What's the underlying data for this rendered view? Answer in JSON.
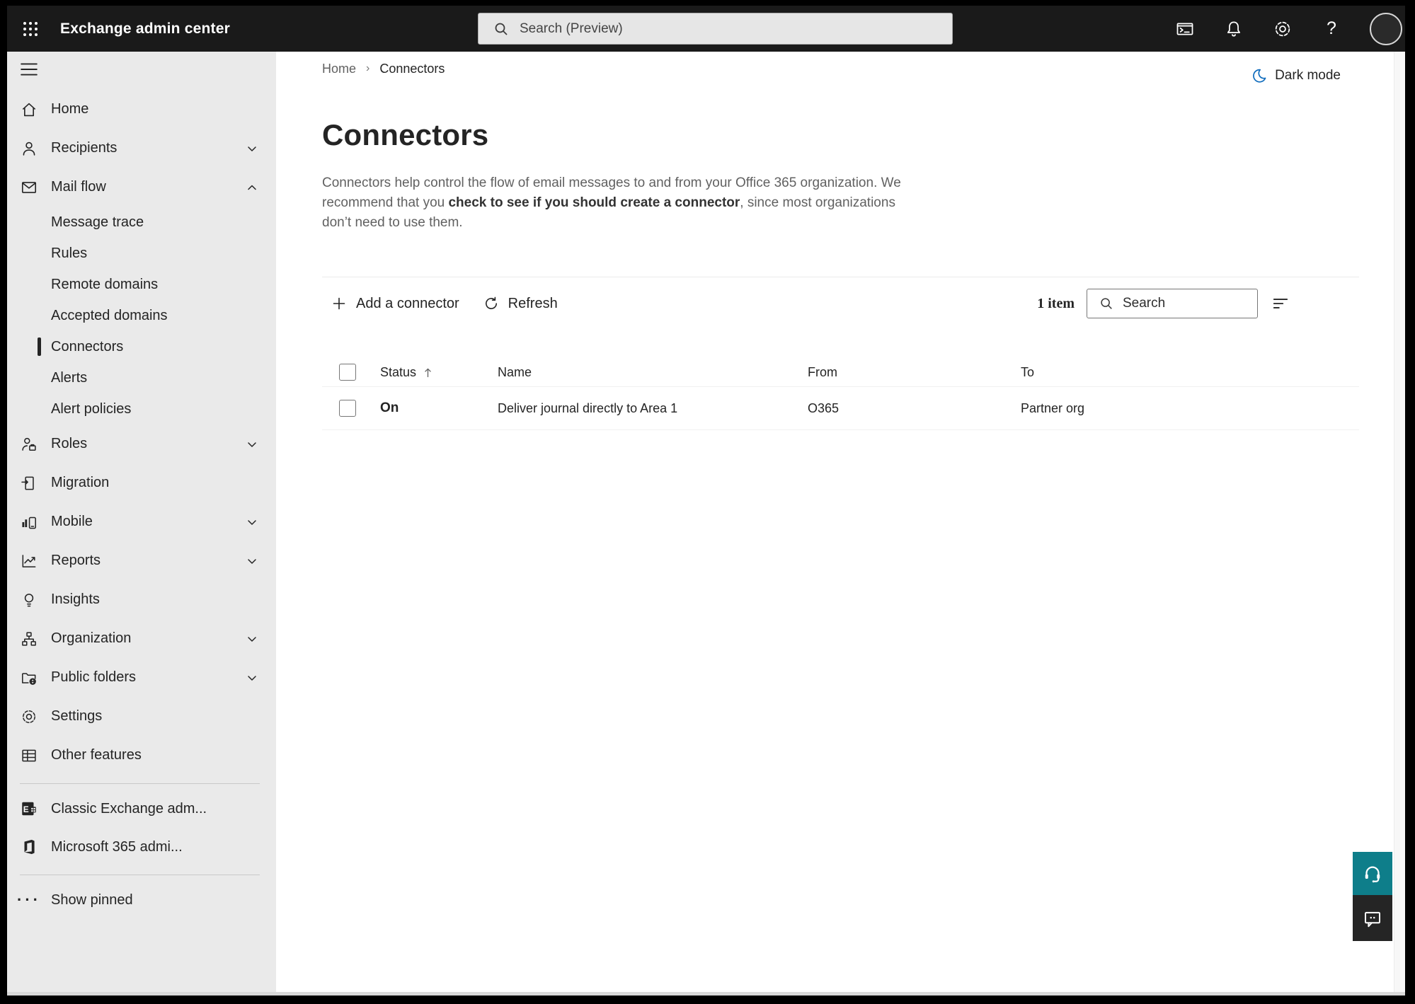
{
  "header": {
    "app_title": "Exchange admin center",
    "search_placeholder": "Search (Preview)",
    "icons": [
      "app-launcher-icon",
      "cloud-shell-icon",
      "bell-icon",
      "gear-icon",
      "help-icon",
      "account-avatar"
    ],
    "help_glyph": "?"
  },
  "breadcrumb": {
    "home": "Home",
    "separator": "›",
    "current": "Connectors"
  },
  "dark_mode": {
    "label": "Dark mode"
  },
  "sidebar": {
    "items": [
      {
        "label": "Home",
        "icon": "home-icon"
      },
      {
        "label": "Recipients",
        "icon": "person-icon",
        "chevron": "down"
      },
      {
        "label": "Mail flow",
        "icon": "mail-icon",
        "chevron": "up",
        "expanded": true
      },
      {
        "label": "Message trace",
        "level": "sub"
      },
      {
        "label": "Rules",
        "level": "sub"
      },
      {
        "label": "Remote domains",
        "level": "sub"
      },
      {
        "label": "Accepted domains",
        "level": "sub"
      },
      {
        "label": "Connectors",
        "level": "sub",
        "selected": true
      },
      {
        "label": "Alerts",
        "level": "sub"
      },
      {
        "label": "Alert policies",
        "level": "sub"
      },
      {
        "label": "Roles",
        "icon": "roles-icon",
        "chevron": "down"
      },
      {
        "label": "Migration",
        "icon": "migration-icon"
      },
      {
        "label": "Mobile",
        "icon": "mobile-icon",
        "chevron": "down"
      },
      {
        "label": "Reports",
        "icon": "reports-icon",
        "chevron": "down"
      },
      {
        "label": "Insights",
        "icon": "insights-icon"
      },
      {
        "label": "Organization",
        "icon": "organization-icon",
        "chevron": "down"
      },
      {
        "label": "Public folders",
        "icon": "public-folders-icon",
        "chevron": "down"
      },
      {
        "label": "Settings",
        "icon": "gear-icon"
      },
      {
        "label": "Other features",
        "icon": "table-grid-icon"
      }
    ],
    "footer_items": [
      {
        "label": "Classic Exchange adm...",
        "icon": "exchange-logo-icon"
      },
      {
        "label": "Microsoft 365 admi...",
        "icon": "microsoft-365-logo-icon"
      }
    ],
    "show_pinned": "Show pinned",
    "ellipsis_glyph": "···"
  },
  "page": {
    "title": "Connectors",
    "description_part1": "Connectors help control the flow of email messages to and from your Office 365 organization. We recommend that you ",
    "description_emphasis": "check to see if you should create a connector",
    "description_part2": ", since most organizations don’t need to use them."
  },
  "toolbar": {
    "add_label": "Add a connector",
    "refresh_label": "Refresh",
    "item_count": "1 item",
    "search_placeholder": "Search"
  },
  "table": {
    "headers": [
      "Status",
      "Name",
      "From",
      "To"
    ],
    "sort_column": "Status",
    "sort_direction": "ascending",
    "rows": [
      {
        "status": "On",
        "name": "Deliver journal directly to Area 1",
        "from": "O365",
        "to": "Partner org"
      }
    ]
  },
  "floating_buttons": {
    "help": "headset-icon",
    "feedback": "feedback-bubble-icon"
  },
  "colors": {
    "header_bg": "#1a1a1a",
    "sidebar_bg": "#eaeaea",
    "accent_teal": "#0e7e8a",
    "feedback_bg": "#252525",
    "dark_mode_icon_blue": "#0f6cbd",
    "text_primary": "#242424",
    "text_secondary": "#616161"
  }
}
